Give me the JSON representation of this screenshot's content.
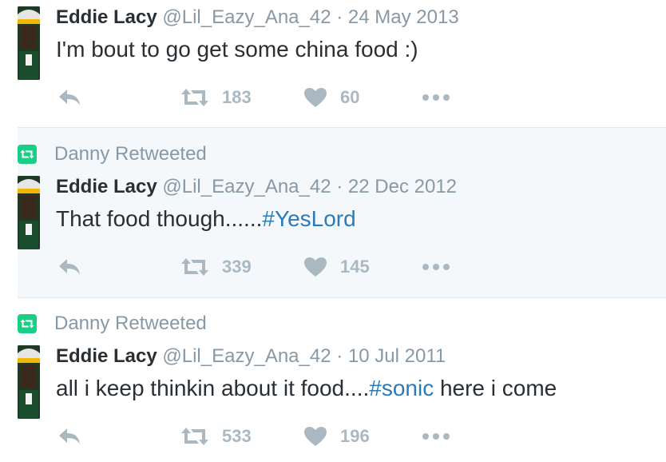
{
  "colors": {
    "text": "#292f33",
    "muted": "#8899a6",
    "action_gray": "#aab8c2",
    "hashtag": "#2b7bb9",
    "retweet_green": "#19cf86",
    "highlight_bg": "#f5f8fa"
  },
  "tweets": [
    {
      "retweeted_by": null,
      "author_name": "Eddie Lacy",
      "handle": "@Lil_Eazy_Ana_42",
      "separator": "·",
      "date": "24 May 2013",
      "text_before": "I'm bout to go get some china food :)",
      "hashtag": "",
      "text_after": "",
      "actions": {
        "reply_icon": "reply-icon",
        "retweet_icon": "retweet-icon",
        "retweets": "183",
        "like_icon": "heart-icon",
        "likes": "60",
        "more_icon": "more-icon"
      }
    },
    {
      "retweeted_by": "Danny Retweeted",
      "author_name": "Eddie Lacy",
      "handle": "@Lil_Eazy_Ana_42",
      "separator": "·",
      "date": "22 Dec 2012",
      "text_before": "That food though......",
      "hashtag": "#YesLord",
      "text_after": "",
      "actions": {
        "reply_icon": "reply-icon",
        "retweet_icon": "retweet-icon",
        "retweets": "339",
        "like_icon": "heart-icon",
        "likes": "145",
        "more_icon": "more-icon"
      }
    },
    {
      "retweeted_by": "Danny Retweeted",
      "author_name": "Eddie Lacy",
      "handle": "@Lil_Eazy_Ana_42",
      "separator": "·",
      "date": "10 Jul 2011",
      "text_before": "all i keep thinkin about it food....",
      "hashtag": "#sonic",
      "text_after": " here i come",
      "actions": {
        "reply_icon": "reply-icon",
        "retweet_icon": "retweet-icon",
        "retweets": "533",
        "like_icon": "heart-icon",
        "likes": "196",
        "more_icon": "more-icon"
      }
    }
  ]
}
